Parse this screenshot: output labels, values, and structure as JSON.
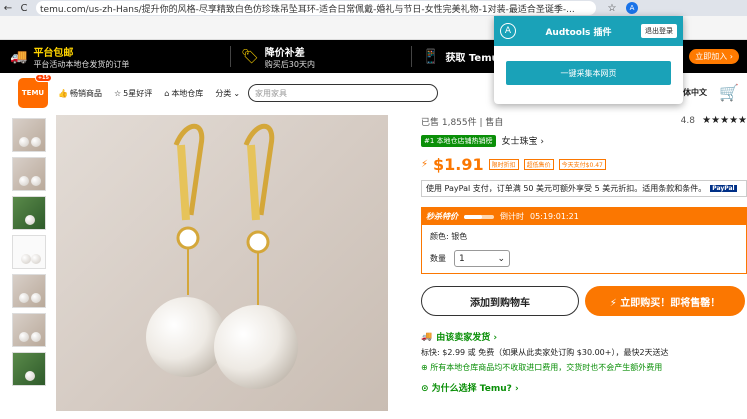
{
  "browser": {
    "url": "temu.com/us-zh-Hans/提升你的风格-尽享精致白色仿珍珠吊坠耳环-适合日常佩戴-婚礼与节日-女性完美礼物-1对装-最适合圣诞季-...",
    "back": "←",
    "reload": "C",
    "star": "☆",
    "ext_badge": "A",
    "ext_extra": "☆"
  },
  "promo": {
    "free_ship_title": "平台包邮",
    "free_ship_sub": "平台活动本地仓发货的订单",
    "subsidy_title": "降价补差",
    "subsidy_sub": "购买后30天内",
    "get_title": "获取 Temu",
    "app_btn": "立即加入 ›"
  },
  "header": {
    "logo": "TEMU",
    "logo_badge": "+15",
    "nav": [
      "畅销商品",
      "5星好评",
      "本地仓库",
      "分类"
    ],
    "search_placeholder": "家用家具",
    "lang": "简体中文"
  },
  "product": {
    "sold": "已售 1,855件",
    "store": "售自",
    "rating": "4.8",
    "stars": "★★★★★",
    "badge": "#1 本地仓店铺热销榜",
    "category": "女士珠宝 ›",
    "price": "$1.91",
    "tags": [
      "限时折扣",
      "超低售价",
      "今天支付$0.47"
    ],
    "paypal_text": "使用 PayPal 支付，订单满 50 美元可额外享受 5 美元折扣。适用条款和条件。",
    "paypal_logo": "PayPal",
    "flash_label": "秒杀特价",
    "countdown_label": "倒计时",
    "countdown": "05:19:01:21",
    "color_label": "颜色: 银色",
    "qty_label": "数量",
    "qty_value": "1",
    "add_cart": "添加到购物车",
    "buy_now": "⚡ 立即购买！即将售罄！",
    "ship_head": "由该卖家发货 ›",
    "ship_line1": "标快: $2.99 或 免费（如果从此卖家处订购 $30.00+），最快2天送达",
    "ship_line2": "⊕ 所有本地仓库商品均不收取进口费用，交货时也不会产生额外费用",
    "why": "⊙ 为什么选择 Temu? ›"
  },
  "popup": {
    "logo": "A",
    "title": "Audtools 插件",
    "logout": "退出登录",
    "collect": "一键采集本网页"
  },
  "colors": {
    "accent": "#fb7701",
    "popup": "#1aa2b8",
    "green": "#0a8f08"
  }
}
